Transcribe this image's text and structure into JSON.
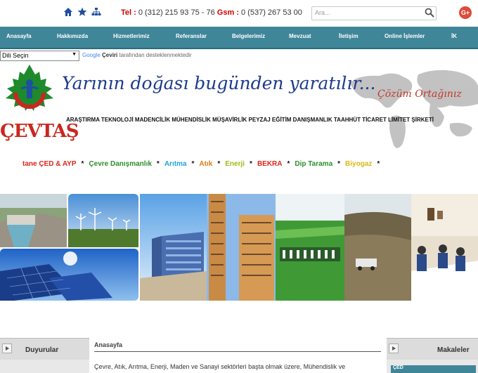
{
  "contact": {
    "tel_label": "Tel :",
    "tel_value": " 0 (312) 215 93 75 - 76 ",
    "gsm_label": "Gsm :",
    "gsm_value": " 0 (537) 267 53 00"
  },
  "search": {
    "placeholder": "Ara..."
  },
  "social": {
    "gplus": "G+"
  },
  "nav": {
    "items": [
      "Anasayfa",
      "Hakkımızda",
      "Hizmetlerimiz",
      "Referanslar",
      "Belgelerimiz",
      "Mevzuat",
      "İletişim",
      "Online İşlemler",
      "İK"
    ]
  },
  "translate": {
    "select_value": "Dili Seçin",
    "google": "Google",
    "ceviri": "Çeviri",
    "suffix": " tarafından desteklenmektedir"
  },
  "banner": {
    "slogan": "Yarının doğası bugünden yaratılır...",
    "cozum": "Çözüm Ortağınız",
    "sectors": "ARAŞTIRMA TEKNOLOJİ MADENCİLİK MÜHENDİSLİK MÜŞAVİRLİK PEYZAJ EĞİTİM DANIŞMANLIK TAAHHÜT TİCARET LİMİTET ŞİRKETİ",
    "logo_text": "ÇEVTAŞ"
  },
  "services": [
    {
      "text": "tane ÇED & AYP",
      "color": "#d9261c"
    },
    {
      "text": "*",
      "color": "#111111"
    },
    {
      "text": "Çevre Danışmanlık",
      "color": "#2a8f2a"
    },
    {
      "text": "*",
      "color": "#111111"
    },
    {
      "text": "Arıtma",
      "color": "#1ea3d6"
    },
    {
      "text": "*",
      "color": "#111111"
    },
    {
      "text": "Atık",
      "color": "#e07b12"
    },
    {
      "text": "*",
      "color": "#111111"
    },
    {
      "text": "Enerji",
      "color": "#a3b817"
    },
    {
      "text": "*",
      "color": "#111111"
    },
    {
      "text": "BEKRA",
      "color": "#d9261c"
    },
    {
      "text": "*",
      "color": "#111111"
    },
    {
      "text": "Dip Tarama",
      "color": "#2a8f2a"
    },
    {
      "text": "*",
      "color": "#111111"
    },
    {
      "text": "Biyogaz",
      "color": "#d9b812"
    },
    {
      "text": "*",
      "color": "#111111"
    }
  ],
  "panels": {
    "duyurular": "Duyurular",
    "makaleler": "Makaleler",
    "makaleler_sub": "ÇED"
  },
  "main": {
    "title": "Anasayfa",
    "text": "Çevre, Atık, Arıtma, Enerji, Maden ve Sanayi sektörleri başta olmak üzere, Mühendislik ve"
  },
  "colors": {
    "nav_bg": "#3f8699",
    "accent_red": "#c8281e",
    "slogan_blue": "#1d3b8c"
  }
}
